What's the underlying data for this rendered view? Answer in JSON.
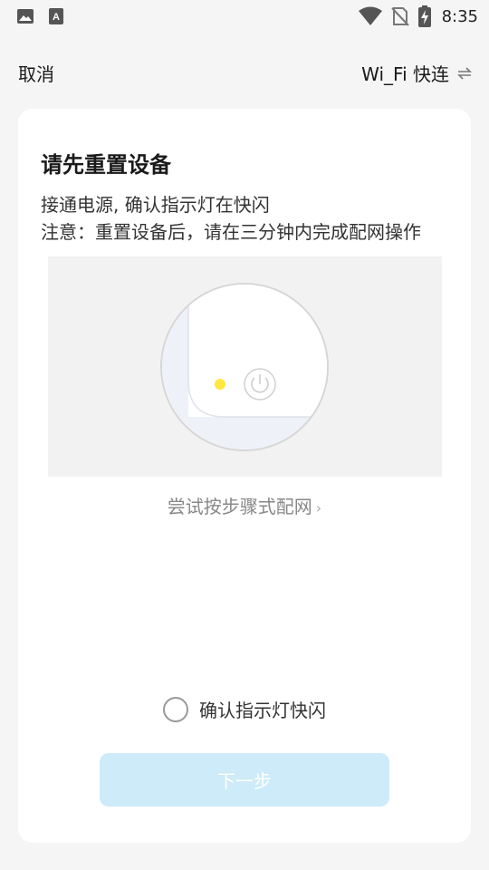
{
  "status_bar": {
    "time": "8:35",
    "left_icons": [
      "image-icon",
      "a-icon"
    ],
    "right_icons": [
      "wifi-icon",
      "no-sim-icon",
      "battery-charging-icon"
    ]
  },
  "header": {
    "cancel_label": "取消",
    "wifi_quick_label": "Wi_Fi 快连",
    "wifi_quick_icon": "swap-arrows-icon"
  },
  "card": {
    "title": "请先重置设备",
    "instruction_line1": "接通电源, 确认指示灯在快闪",
    "instruction_line2": "注意：重置设备后，请在三分钟内完成配网操作",
    "try_steps_label": "尝试按步骤式配网",
    "confirm_label": "确认指示灯快闪",
    "next_label": "下一步"
  },
  "colors": {
    "indicator_light": "#ffe83d",
    "next_button_bg": "#cdebf8",
    "card_bg": "#ffffff",
    "page_bg": "#f5f5f5"
  }
}
